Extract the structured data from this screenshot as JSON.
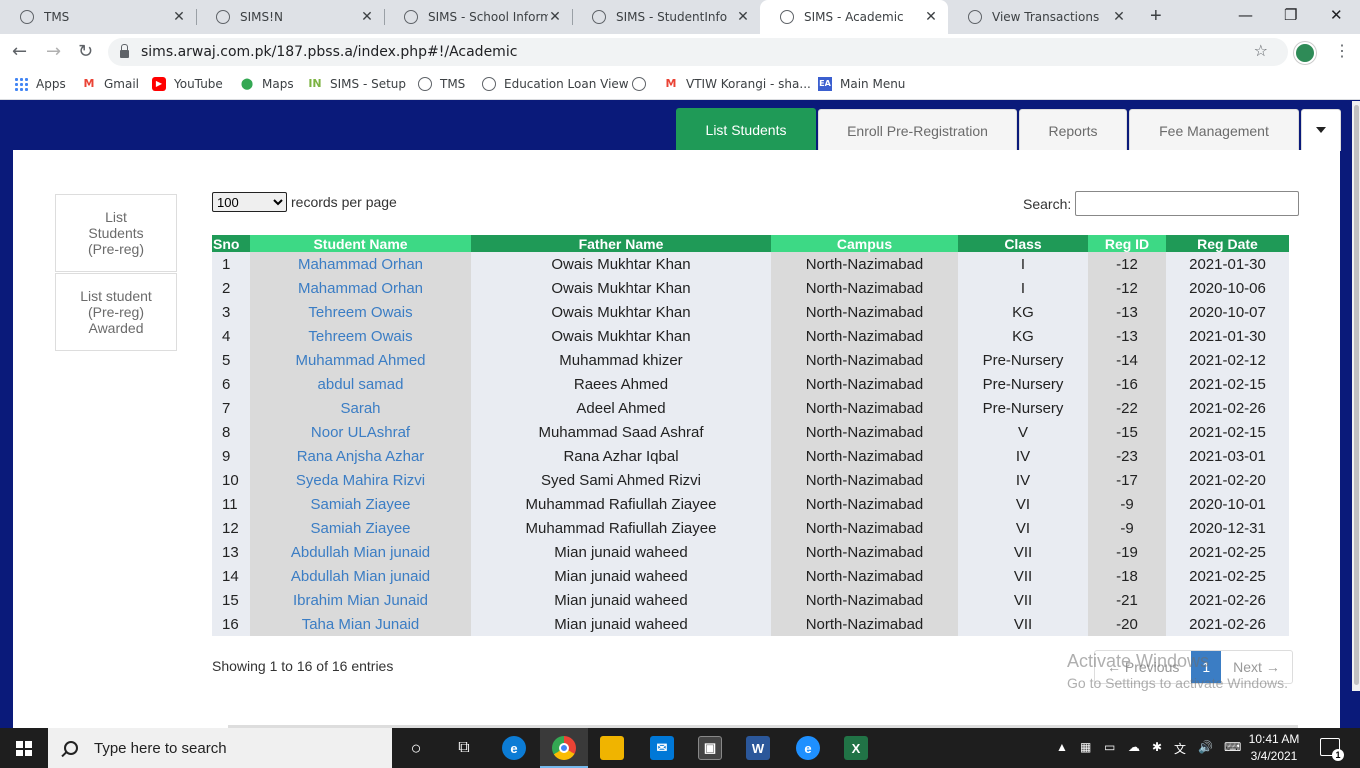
{
  "browser": {
    "tabs": [
      {
        "title": "TMS"
      },
      {
        "title": "SIMS!N"
      },
      {
        "title": "SIMS - School Informat"
      },
      {
        "title": "SIMS - StudentInfo"
      },
      {
        "title": "SIMS - Academic"
      },
      {
        "title": "View Transactions"
      }
    ],
    "url": "sims.arwaj.com.pk/187.pbss.a/index.php#!/Academic",
    "bookmarks": [
      "Apps",
      "Gmail",
      "YouTube",
      "Maps",
      "SIMS - Setup",
      "TMS",
      "Education Loan View",
      "",
      "VTIW Korangi - sha...",
      "Main Menu"
    ]
  },
  "nav": {
    "tabs": [
      "List Students",
      "Enroll Pre-Registration",
      "Reports",
      "Fee Management"
    ],
    "active": "List Students"
  },
  "sidebar": {
    "items": [
      "List\nStudents\n(Pre-reg)",
      "List student\n(Pre-reg)\nAwarded"
    ]
  },
  "table_controls": {
    "length_value": "100",
    "length_label": "records per page",
    "search_label": "Search:",
    "search_value": ""
  },
  "table": {
    "headers": [
      "Sno",
      "Student Name",
      "Father Name",
      "Campus",
      "Class",
      "Reg ID",
      "Reg Date"
    ],
    "rows": [
      [
        "1",
        "Mahammad Orhan",
        "Owais Mukhtar Khan",
        "North-Nazimabad",
        "I",
        "-12",
        "2021-01-30"
      ],
      [
        "2",
        "Mahammad Orhan",
        "Owais Mukhtar Khan",
        "North-Nazimabad",
        "I",
        "-12",
        "2020-10-06"
      ],
      [
        "3",
        "Tehreem Owais",
        "Owais Mukhtar Khan",
        "North-Nazimabad",
        "KG",
        "-13",
        "2020-10-07"
      ],
      [
        "4",
        "Tehreem Owais",
        "Owais Mukhtar Khan",
        "North-Nazimabad",
        "KG",
        "-13",
        "2021-01-30"
      ],
      [
        "5",
        "Muhammad Ahmed",
        "Muhammad khizer",
        "North-Nazimabad",
        "Pre-Nursery",
        "-14",
        "2021-02-12"
      ],
      [
        "6",
        "abdul samad",
        "Raees Ahmed",
        "North-Nazimabad",
        "Pre-Nursery",
        "-16",
        "2021-02-15"
      ],
      [
        "7",
        "Sarah",
        "Adeel Ahmed",
        "North-Nazimabad",
        "Pre-Nursery",
        "-22",
        "2021-02-26"
      ],
      [
        "8",
        "Noor ULAshraf",
        "Muhammad Saad Ashraf",
        "North-Nazimabad",
        "V",
        "-15",
        "2021-02-15"
      ],
      [
        "9",
        "Rana Anjsha Azhar",
        "Rana Azhar Iqbal",
        "North-Nazimabad",
        "IV",
        "-23",
        "2021-03-01"
      ],
      [
        "10",
        "Syeda Mahira Rizvi",
        "Syed Sami Ahmed Rizvi",
        "North-Nazimabad",
        "IV",
        "-17",
        "2021-02-20"
      ],
      [
        "11",
        "Samiah Ziayee",
        "Muhammad Rafiullah Ziayee",
        "North-Nazimabad",
        "VI",
        "-9",
        "2020-10-01"
      ],
      [
        "12",
        "Samiah Ziayee",
        "Muhammad Rafiullah Ziayee",
        "North-Nazimabad",
        "VI",
        "-9",
        "2020-12-31"
      ],
      [
        "13",
        "Abdullah Mian junaid",
        "Mian junaid waheed",
        "North-Nazimabad",
        "VII",
        "-19",
        "2021-02-25"
      ],
      [
        "14",
        "Abdullah Mian junaid",
        "Mian junaid waheed",
        "North-Nazimabad",
        "VII",
        "-18",
        "2021-02-25"
      ],
      [
        "15",
        "Ibrahim Mian Junaid",
        "Mian junaid waheed",
        "North-Nazimabad",
        "VII",
        "-21",
        "2021-02-26"
      ],
      [
        "16",
        "Taha Mian Junaid",
        "Mian junaid waheed",
        "North-Nazimabad",
        "VII",
        "-20",
        "2021-02-26"
      ]
    ]
  },
  "footer": {
    "info": "Showing 1 to 16 of 16 entries",
    "prev": "← Previous",
    "page": "1",
    "next": "Next →"
  },
  "watermark": {
    "line1": "Activate Windows",
    "line2": "Go to Settings to activate Windows."
  },
  "taskbar": {
    "search_placeholder": "Type here to search",
    "time": "10:41 AM",
    "date": "3/4/2021",
    "notifications": "1"
  },
  "colors": {
    "header_dark": "#1f9a57",
    "header_light": "#3dd985",
    "page_bg": "#0a1a7a",
    "link": "#3b7dc4"
  }
}
